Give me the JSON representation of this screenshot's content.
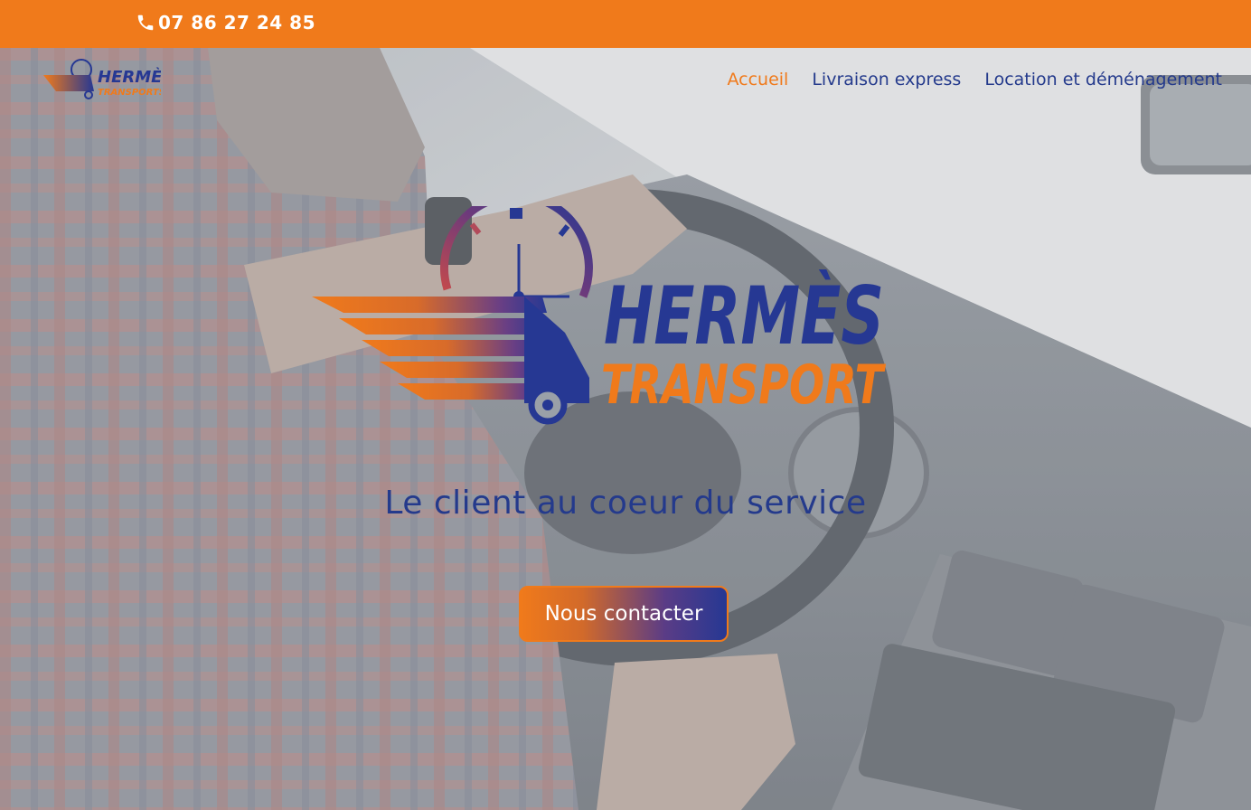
{
  "topbar": {
    "phone_icon": "phone-icon",
    "phone": "07 86 27 24 85"
  },
  "header": {
    "logo_line1": "HERMÈS",
    "logo_line2": "TRANSPORTS",
    "nav": [
      {
        "label": "Accueil",
        "active": true
      },
      {
        "label": "Livraison express",
        "active": false
      },
      {
        "label": "Location et déménagement",
        "active": false
      }
    ]
  },
  "hero": {
    "logo_line1": "HERMÈS",
    "logo_line2": "TRANSPORT",
    "tagline": "Le client au coeur du service",
    "cta_label": "Nous contacter"
  },
  "colors": {
    "orange": "#f07a1b",
    "blue": "#243a8c",
    "overlay": "#9aa0a8"
  }
}
